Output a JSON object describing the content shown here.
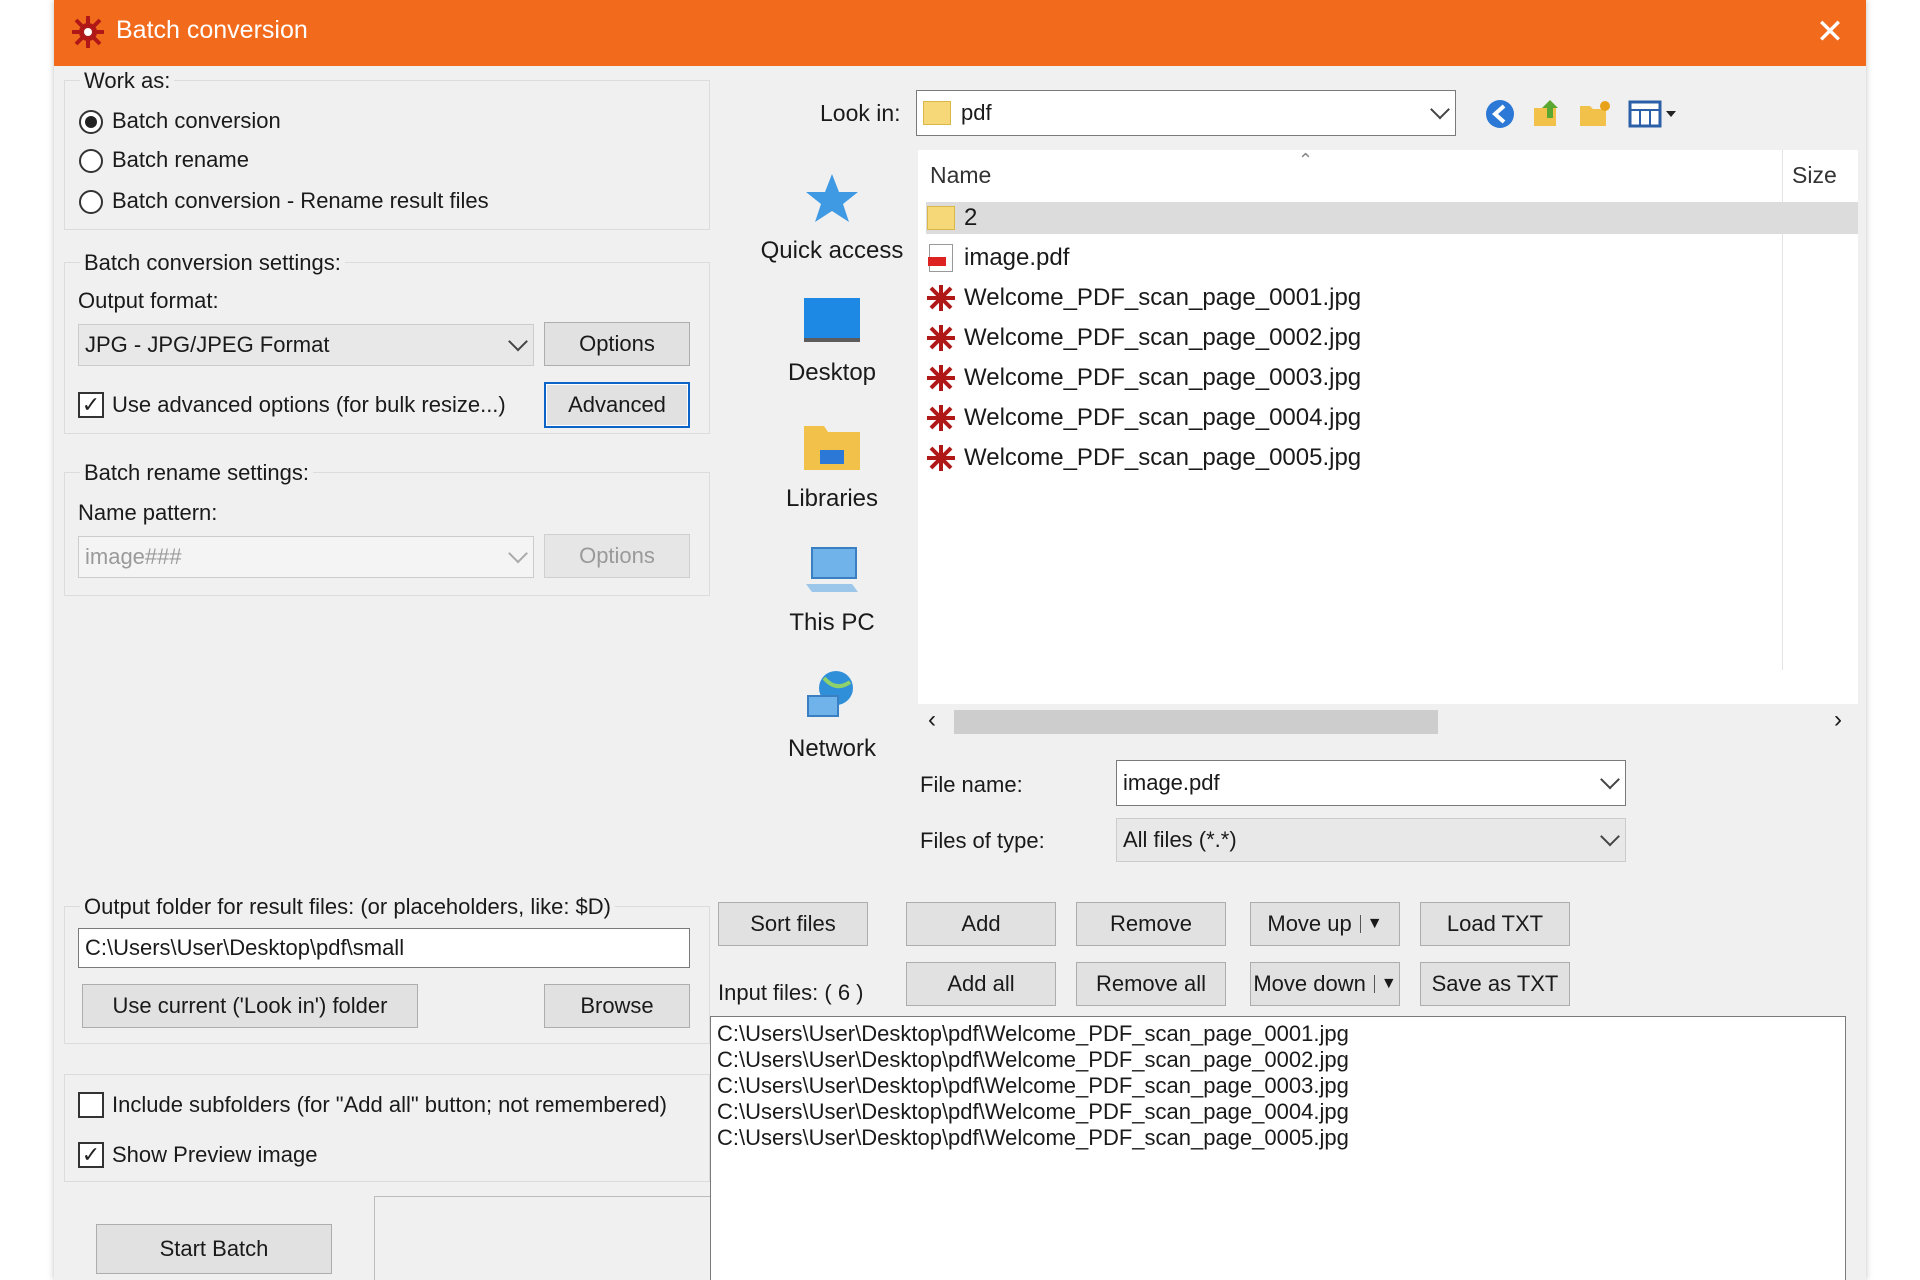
{
  "window": {
    "title": "Batch conversion",
    "colors": {
      "titlebar": "#f26b1d",
      "accent": "#0a64c9"
    }
  },
  "work_as": {
    "label": "Work as:",
    "options": [
      "Batch conversion",
      "Batch rename",
      "Batch conversion - Rename result files"
    ],
    "selected": "Batch conversion"
  },
  "conversion_settings": {
    "label": "Batch conversion settings:",
    "output_format_label": "Output format:",
    "output_format_value": "JPG - JPG/JPEG Format",
    "options_button": "Options",
    "advanced_checkbox_label": "Use advanced options (for bulk resize...)",
    "advanced_checked": true,
    "advanced_button": "Advanced"
  },
  "rename_settings": {
    "label": "Batch rename settings:",
    "name_pattern_label": "Name pattern:",
    "name_pattern_value": "image###",
    "options_button": "Options"
  },
  "output_folder": {
    "label": "Output folder for result files: (or placeholders, like: $D)",
    "value": "C:\\Users\\User\\Desktop\\pdf\\small",
    "use_current_button": "Use current ('Look in') folder",
    "browse_button": "Browse"
  },
  "flags": {
    "include_subfolders_label": "Include subfolders (for \"Add all\" button; not remembered)",
    "include_subfolders_checked": false,
    "show_preview_label": "Show Preview image",
    "show_preview_checked": true
  },
  "start_button": "Start Batch",
  "browser": {
    "look_in_label": "Look in:",
    "look_in_value": "pdf",
    "toolbar_icons": [
      "back-icon",
      "up-folder-icon",
      "new-folder-icon",
      "view-menu-icon"
    ],
    "places": [
      "Quick access",
      "Desktop",
      "Libraries",
      "This PC",
      "Network"
    ],
    "columns": {
      "name": "Name",
      "size": "Size"
    },
    "files": [
      {
        "name": "2",
        "type": "folder",
        "selected": true
      },
      {
        "name": "image.pdf",
        "type": "pdf"
      },
      {
        "name": "Welcome_PDF_scan_page_0001.jpg",
        "type": "jpg"
      },
      {
        "name": "Welcome_PDF_scan_page_0002.jpg",
        "type": "jpg"
      },
      {
        "name": "Welcome_PDF_scan_page_0003.jpg",
        "type": "jpg"
      },
      {
        "name": "Welcome_PDF_scan_page_0004.jpg",
        "type": "jpg"
      },
      {
        "name": "Welcome_PDF_scan_page_0005.jpg",
        "type": "jpg"
      }
    ],
    "file_name_label": "File name:",
    "file_name_value": "image.pdf",
    "files_of_type_label": "Files of type:",
    "files_of_type_value": "All files (*.*)"
  },
  "list_buttons": {
    "sort": "Sort files",
    "add": "Add",
    "add_all": "Add all",
    "remove": "Remove",
    "remove_all": "Remove all",
    "move_up": "Move up",
    "move_down": "Move down",
    "load_txt": "Load TXT",
    "save_txt": "Save as TXT"
  },
  "input_files": {
    "label": "Input files: ( 6 )",
    "items": [
      "C:\\Users\\User\\Desktop\\pdf\\Welcome_PDF_scan_page_0001.jpg",
      "C:\\Users\\User\\Desktop\\pdf\\Welcome_PDF_scan_page_0002.jpg",
      "C:\\Users\\User\\Desktop\\pdf\\Welcome_PDF_scan_page_0003.jpg",
      "C:\\Users\\User\\Desktop\\pdf\\Welcome_PDF_scan_page_0004.jpg",
      "C:\\Users\\User\\Desktop\\pdf\\Welcome_PDF_scan_page_0005.jpg"
    ]
  }
}
